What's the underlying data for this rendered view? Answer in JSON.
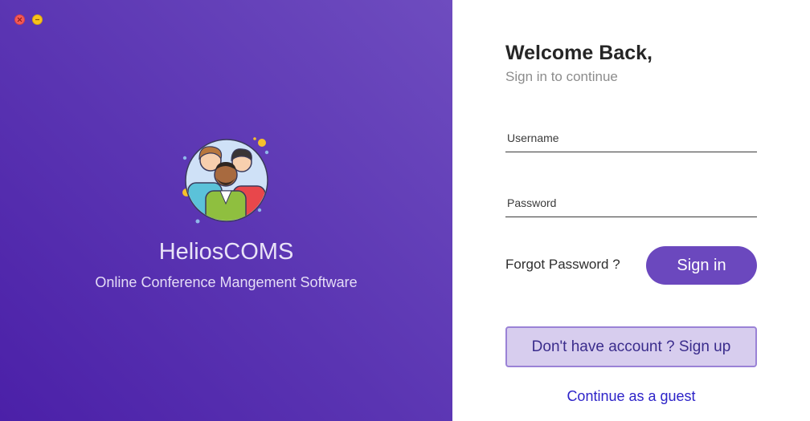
{
  "window_controls": {
    "close_color": "#f45a58",
    "minimize_color": "#f8c21c"
  },
  "brand": {
    "logo_icon": "team-users-icon",
    "title": "HeliosCOMS",
    "subtitle": "Online Conference Mangement Software",
    "gradient_start": "#4b20a8",
    "gradient_end": "#6e4cbf"
  },
  "login": {
    "heading": "Welcome Back,",
    "subheading": "Sign in to continue",
    "username_placeholder": "Username",
    "username_value": "",
    "password_placeholder": "Password",
    "password_value": "",
    "forgot_label": "Forgot Password ?",
    "signin_label": "Sign in",
    "signup_label": "Don't have account ? Sign up",
    "guest_label": "Continue as a guest",
    "accent_color": "#6b48be",
    "link_color": "#2d23c8"
  }
}
